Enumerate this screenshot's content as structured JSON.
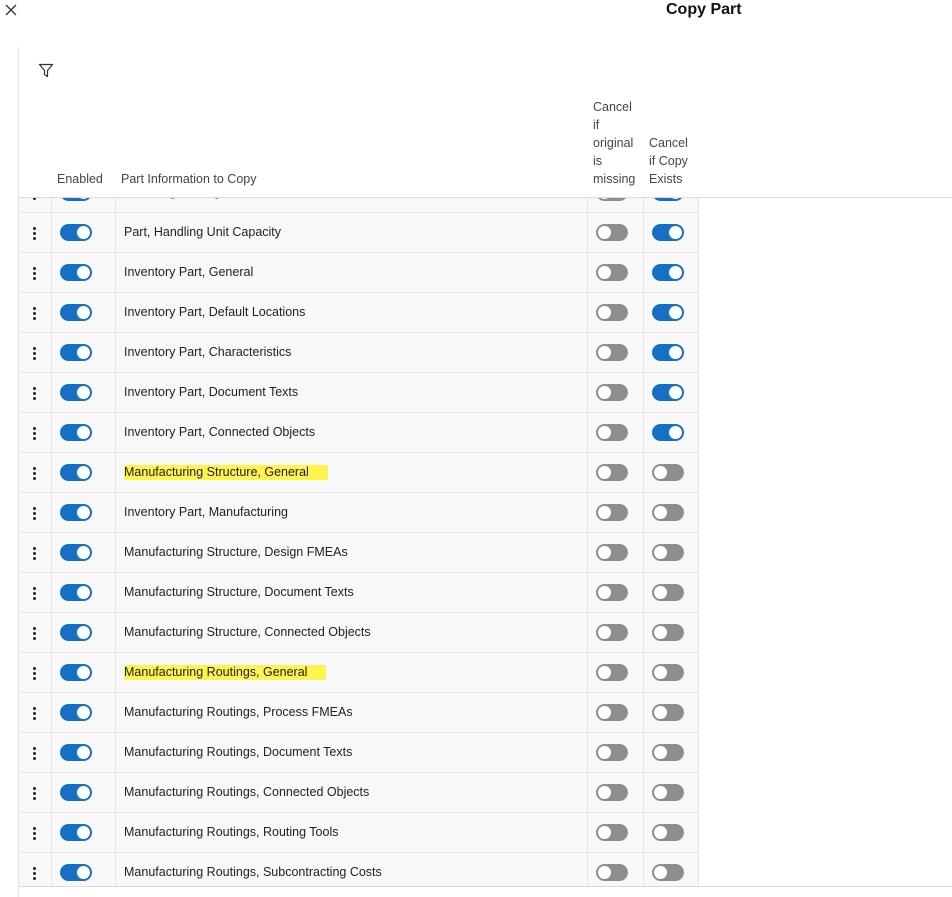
{
  "dialog": {
    "title": "Copy Part"
  },
  "icons": {
    "close": "close-icon",
    "filter": "filter-icon",
    "row_menu": "more-vertical-icon"
  },
  "colors": {
    "toggle_on": "#1570c4",
    "toggle_off": "#8e8e8e",
    "highlight": "#fff34d"
  },
  "table": {
    "headers": {
      "enabled": "Enabled",
      "part_info": "Part Information to Copy",
      "cancel_if_missing": [
        "Cancel",
        "if",
        "original",
        "is",
        "missing"
      ],
      "cancel_if_exists": [
        "Cancel",
        "if Copy",
        "Exists"
      ]
    },
    "rows": [
      {
        "label": "Part, Engineering",
        "enabled": true,
        "cancel_if_missing": false,
        "cancel_if_exists": true,
        "highlighted": false
      },
      {
        "label": "Part, Handling Unit Capacity",
        "enabled": true,
        "cancel_if_missing": false,
        "cancel_if_exists": true,
        "highlighted": false
      },
      {
        "label": "Inventory Part, General",
        "enabled": true,
        "cancel_if_missing": false,
        "cancel_if_exists": true,
        "highlighted": false
      },
      {
        "label": "Inventory Part, Default Locations",
        "enabled": true,
        "cancel_if_missing": false,
        "cancel_if_exists": true,
        "highlighted": false
      },
      {
        "label": "Inventory Part, Characteristics",
        "enabled": true,
        "cancel_if_missing": false,
        "cancel_if_exists": true,
        "highlighted": false
      },
      {
        "label": "Inventory Part, Document Texts",
        "enabled": true,
        "cancel_if_missing": false,
        "cancel_if_exists": true,
        "highlighted": false
      },
      {
        "label": "Inventory Part, Connected Objects",
        "enabled": true,
        "cancel_if_missing": false,
        "cancel_if_exists": true,
        "highlighted": false
      },
      {
        "label": "Manufacturing Structure, General",
        "enabled": true,
        "cancel_if_missing": false,
        "cancel_if_exists": false,
        "highlighted": true
      },
      {
        "label": "Inventory Part, Manufacturing",
        "enabled": true,
        "cancel_if_missing": false,
        "cancel_if_exists": false,
        "highlighted": false
      },
      {
        "label": "Manufacturing Structure, Design FMEAs",
        "enabled": true,
        "cancel_if_missing": false,
        "cancel_if_exists": false,
        "highlighted": false
      },
      {
        "label": "Manufacturing Structure, Document Texts",
        "enabled": true,
        "cancel_if_missing": false,
        "cancel_if_exists": false,
        "highlighted": false
      },
      {
        "label": "Manufacturing Structure, Connected Objects",
        "enabled": true,
        "cancel_if_missing": false,
        "cancel_if_exists": false,
        "highlighted": false
      },
      {
        "label": "Manufacturing Routings, General",
        "enabled": true,
        "cancel_if_missing": false,
        "cancel_if_exists": false,
        "highlighted": true
      },
      {
        "label": "Manufacturing Routings, Process FMEAs",
        "enabled": true,
        "cancel_if_missing": false,
        "cancel_if_exists": false,
        "highlighted": false
      },
      {
        "label": "Manufacturing Routings, Document Texts",
        "enabled": true,
        "cancel_if_missing": false,
        "cancel_if_exists": false,
        "highlighted": false
      },
      {
        "label": "Manufacturing Routings, Connected Objects",
        "enabled": true,
        "cancel_if_missing": false,
        "cancel_if_exists": false,
        "highlighted": false
      },
      {
        "label": "Manufacturing Routings, Routing Tools",
        "enabled": true,
        "cancel_if_missing": false,
        "cancel_if_exists": false,
        "highlighted": false
      },
      {
        "label": "Manufacturing Routings, Subcontracting Costs",
        "enabled": true,
        "cancel_if_missing": false,
        "cancel_if_exists": false,
        "highlighted": false
      }
    ]
  }
}
